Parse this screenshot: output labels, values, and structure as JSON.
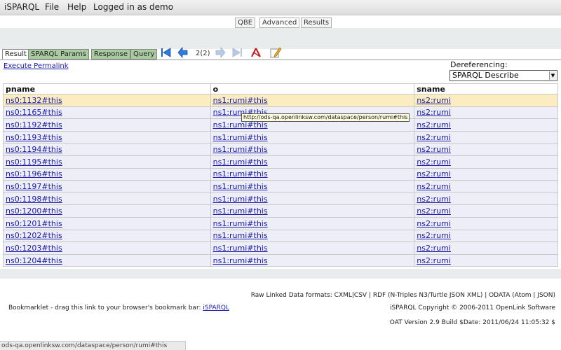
{
  "menubar": {
    "app": "iSPARQL",
    "file": "File",
    "help": "Help",
    "login": "Logged in as demo"
  },
  "views": {
    "qbe": "QBE",
    "advanced": "Advanced",
    "results": "Results"
  },
  "tabs": {
    "result": "Result",
    "sparql_params": "SPARQL Params",
    "response": "Response",
    "query": "Query"
  },
  "pager": {
    "count": "2(2)"
  },
  "toolbar_icons": [
    "first-page-icon",
    "previous-page-icon",
    "next-page-icon",
    "last-page-icon",
    "graph-icon",
    "edit-icon"
  ],
  "execute_permalink": "Execute Permalink",
  "dereferencing": {
    "label": "Dereferencing:",
    "selected": "SPARQL Describe"
  },
  "table": {
    "headers": [
      "pname",
      "o",
      "sname"
    ],
    "rows": [
      [
        "ns0:1132#this",
        "ns1:rumi#this",
        "ns2:rumi"
      ],
      [
        "ns0:1165#this",
        "ns1:rumi#this",
        "ns2:rumi"
      ],
      [
        "ns0:1192#this",
        "ns1:rumi#this",
        "ns2:rumi"
      ],
      [
        "ns0:1193#this",
        "ns1:rumi#this",
        "ns2:rumi"
      ],
      [
        "ns0:1194#this",
        "ns1:rumi#this",
        "ns2:rumi"
      ],
      [
        "ns0:1195#this",
        "ns1:rumi#this",
        "ns2:rumi"
      ],
      [
        "ns0:1196#this",
        "ns1:rumi#this",
        "ns2:rumi"
      ],
      [
        "ns0:1197#this",
        "ns1:rumi#this",
        "ns2:rumi"
      ],
      [
        "ns0:1198#this",
        "ns1:rumi#this",
        "ns2:rumi"
      ],
      [
        "ns0:1200#this",
        "ns1:rumi#this",
        "ns2:rumi"
      ],
      [
        "ns0:1201#this",
        "ns1:rumi#this",
        "ns2:rumi"
      ],
      [
        "ns0:1202#this",
        "ns1:rumi#this",
        "ns2:rumi"
      ],
      [
        "ns0:1203#this",
        "ns1:rumi#this",
        "ns2:rumi"
      ],
      [
        "ns0:1204#this",
        "ns1:rumi#this",
        "ns2:rumi"
      ]
    ]
  },
  "tooltip": "http://ods-qa.openlinksw.com/dataspace/person/rumi#this",
  "footer": {
    "formats": "Raw Linked Data formats: CXML|CSV | RDF (N-Triples N3/Turtle JSON XML) | ODATA (Atom | JSON)",
    "bookmarklet_prefix": "Bookmarklet - drag this link to your browser's bookmark bar:",
    "bookmarklet_link": "iSPARQL",
    "copyright": "iSPARQL Copyright © 2006-2011 OpenLink Software",
    "version": "OAT Version 2.9 Build $Date: 2011/06/24 11:05:32 $"
  },
  "statusbar": "ods-qa.openlinksw.com/dataspace/person/rumi#this",
  "colors": {
    "link": "#1a1aa8",
    "row_bg": "#eeeef8",
    "row_highlight": "#fbedbf",
    "tab_green": "#a8cca0"
  }
}
